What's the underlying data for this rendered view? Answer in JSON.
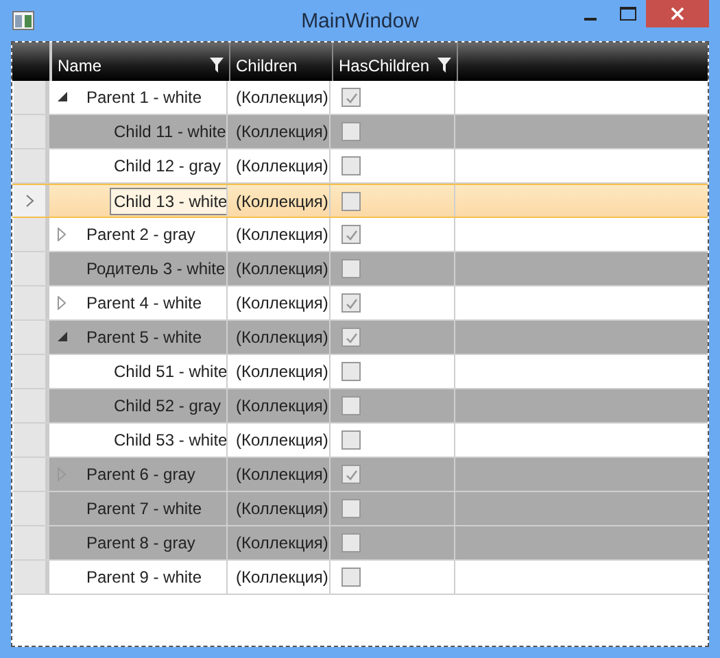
{
  "window": {
    "title": "MainWindow"
  },
  "columns": [
    {
      "label": "Name",
      "filter": true
    },
    {
      "label": "Children",
      "filter": false
    },
    {
      "label": "HasChildren",
      "filter": true
    }
  ],
  "rows": [
    {
      "name": "Parent 1 - white",
      "children_cell": "(Коллекция)",
      "has_children": true,
      "shaded": false,
      "selected": false,
      "expanded": true,
      "children": [
        {
          "name": "Child 11 - white",
          "children_cell": "(Коллекция)",
          "has_children": false,
          "shaded": true,
          "selected": false
        },
        {
          "name": "Child 12 - gray",
          "children_cell": "(Коллекция)",
          "has_children": false,
          "shaded": false,
          "selected": false
        },
        {
          "name": "Child 13 - white",
          "children_cell": "(Коллекция)",
          "has_children": false,
          "shaded": false,
          "selected": true
        }
      ]
    },
    {
      "name": "Parent 2 - gray",
      "children_cell": "(Коллекция)",
      "has_children": true,
      "shaded": false,
      "selected": false,
      "expanded": false
    },
    {
      "name": "Родитель 3 - white",
      "children_cell": "(Коллекция)",
      "has_children": false,
      "shaded": true,
      "selected": false
    },
    {
      "name": "Parent 4 - white",
      "children_cell": "(Коллекция)",
      "has_children": true,
      "shaded": false,
      "selected": false,
      "expanded": false
    },
    {
      "name": "Parent 5 - white",
      "children_cell": "(Коллекция)",
      "has_children": true,
      "shaded": true,
      "selected": false,
      "expanded": true,
      "children": [
        {
          "name": "Child 51 - white",
          "children_cell": "(Коллекция)",
          "has_children": false,
          "shaded": false,
          "selected": false
        },
        {
          "name": "Child 52 - gray",
          "children_cell": "(Коллекция)",
          "has_children": false,
          "shaded": true,
          "selected": false
        },
        {
          "name": "Child 53 - white",
          "children_cell": "(Коллекция)",
          "has_children": false,
          "shaded": false,
          "selected": false
        }
      ]
    },
    {
      "name": "Parent 6 - gray",
      "children_cell": "(Коллекция)",
      "has_children": true,
      "shaded": true,
      "selected": false,
      "expanded": false
    },
    {
      "name": "Parent 7 - white",
      "children_cell": "(Коллекция)",
      "has_children": false,
      "shaded": true,
      "selected": false
    },
    {
      "name": "Parent 8 - gray",
      "children_cell": "(Коллекция)",
      "has_children": false,
      "shaded": true,
      "selected": false
    },
    {
      "name": "Parent 9 - white",
      "children_cell": "(Коллекция)",
      "has_children": false,
      "shaded": false,
      "selected": false
    }
  ]
}
